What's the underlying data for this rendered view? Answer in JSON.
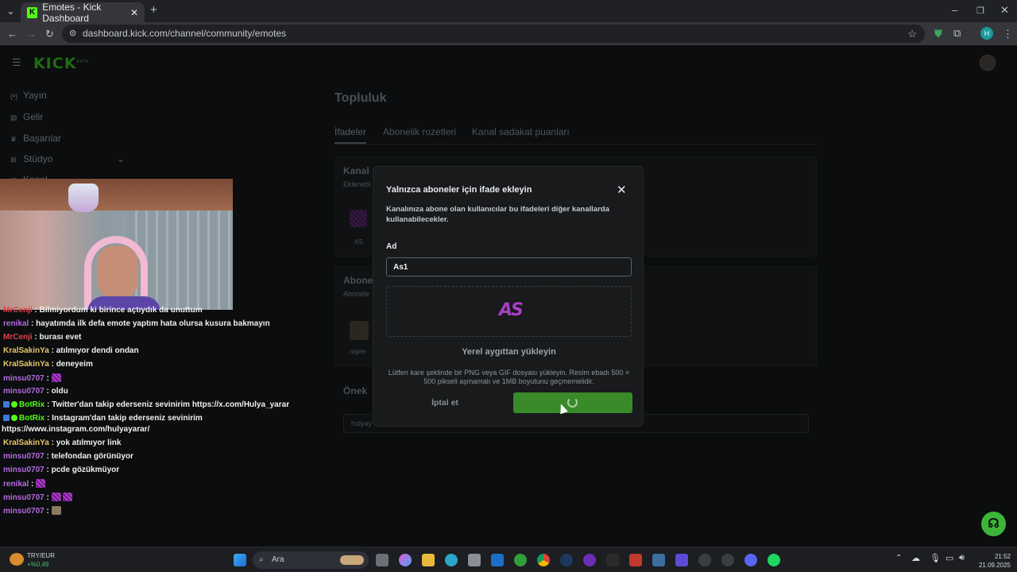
{
  "browser": {
    "tab_title": "Emotes - Kick Dashboard",
    "url": "dashboard.kick.com/channel/community/emotes",
    "profile_initial": "H"
  },
  "sidebar": {
    "logo": "KICK",
    "logo_badge": "BETA",
    "items": [
      {
        "label": "Yayın",
        "icon": "broadcast-icon"
      },
      {
        "label": "Gelir",
        "icon": "revenue-icon"
      },
      {
        "label": "Başarılar",
        "icon": "trophy-icon"
      },
      {
        "label": "Stüdyo",
        "icon": "studio-icon"
      },
      {
        "label": "Kanal",
        "icon": "channel-icon"
      }
    ]
  },
  "main": {
    "title": "Topluluk",
    "tabs": [
      "İfadeler",
      "Abonelik rozetleri",
      "Kanal sadakat puanları"
    ],
    "section1_title": "Kanal",
    "section1_sub": "Eklenebi",
    "emote1_name": "AS",
    "section2_title": "Abone",
    "section2_sub": "Abonele",
    "emote2_name": "ragee",
    "section3_title": "Önek",
    "prefix_value": "hulyay"
  },
  "modal": {
    "title": "Yalnızca aboneler için ifade ekleyin",
    "description": "Kanalınıza abone olan kullanıcılar bu ifadeleri diğer kanallarda kullanabilecekler.",
    "name_label": "Ad",
    "name_value": "As1",
    "preview_text": "AS",
    "upload_label": "Yerel aygıttan yükleyin",
    "hint": "Lütfen kare şeklinde bir PNG veya GIF dosyası yükleyin. Resim ebadı 500 × 500 pikseli aşmamalı ve 1MB boyutunu geçmemelidir.",
    "cancel_label": "İptal et"
  },
  "chat": {
    "messages": [
      {
        "user": "MrCenji",
        "color": "#e0404a",
        "text": ": Bilmiyordum ki birince açtıydık da unuttum",
        "emotes": 0
      },
      {
        "user": "renikal",
        "color": "#b46be0",
        "text": ": hayatımda ilk defa emote yaptım hata olursa kusura bakmayın",
        "emotes": 0
      },
      {
        "user": "MrCenji",
        "color": "#e0404a",
        "text": ": burası evet",
        "emotes": 0
      },
      {
        "user": "KralSakinYa",
        "color": "#e8c66a",
        "text": ": atılmıyor dendi ondan",
        "emotes": 0
      },
      {
        "user": "KralSakinYa",
        "color": "#e8c66a",
        "text": ": deneyeim",
        "emotes": 0
      },
      {
        "user": "minsu0707",
        "color": "#b46be0",
        "text": ":",
        "emotes": 1
      },
      {
        "user": "minsu0707",
        "color": "#b46be0",
        "text": ": oldu",
        "emotes": 0
      },
      {
        "user": "BotRix",
        "color": "#53fc18",
        "text": ": Twitter'dan takip ederseniz sevinirim https://x.com/Hulya_yarar",
        "emotes": 0
      },
      {
        "user": "BotRix",
        "color": "#53fc18",
        "text": ": Instagram'dan takip ederseniz sevinirim",
        "emotes": 0
      },
      {
        "user": "",
        "color": "#f0f0f0",
        "text": "https://www.instagram.com/hulyayarar/",
        "emotes": 0
      },
      {
        "user": "KralSakinYa",
        "color": "#e8c66a",
        "text": ": yok atılmıyor link",
        "emotes": 0
      },
      {
        "user": "minsu0707",
        "color": "#b46be0",
        "text": ": telefondan görünüyor",
        "emotes": 0
      },
      {
        "user": "minsu0707",
        "color": "#b46be0",
        "text": ": pcde gözükmüyor",
        "emotes": 0
      },
      {
        "user": "renikal",
        "color": "#b46be0",
        "text": ":",
        "emotes": 1
      },
      {
        "user": "minsu0707",
        "color": "#b46be0",
        "text": ":",
        "emotes": 2
      },
      {
        "user": "minsu0707",
        "color": "#b46be0",
        "text": ":",
        "emotes": 3
      }
    ]
  },
  "taskbar": {
    "search_placeholder": "Ara",
    "ticker_pair": "TRY/EUR",
    "ticker_change": "+%0,49",
    "time": "21:52",
    "date": "21.09.2025"
  },
  "colors": {
    "brand": "#53fc18",
    "save_button": "#3a8a2a"
  }
}
